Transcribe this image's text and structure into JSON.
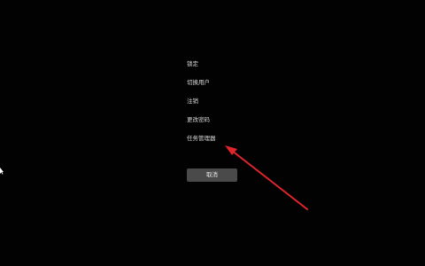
{
  "security_menu": {
    "items": [
      {
        "label": "锁定"
      },
      {
        "label": "切换用户"
      },
      {
        "label": "注销"
      },
      {
        "label": "更改密码"
      },
      {
        "label": "任务管理器"
      }
    ],
    "cancel_label": "取消"
  },
  "colors": {
    "background": "#020202",
    "text": "#d9d9d9",
    "button": "#4a4a4a",
    "annotation_arrow": "#e0262b"
  },
  "icons": {
    "cursor": "mouse-pointer-icon",
    "annotation": "red-arrow-icon"
  }
}
